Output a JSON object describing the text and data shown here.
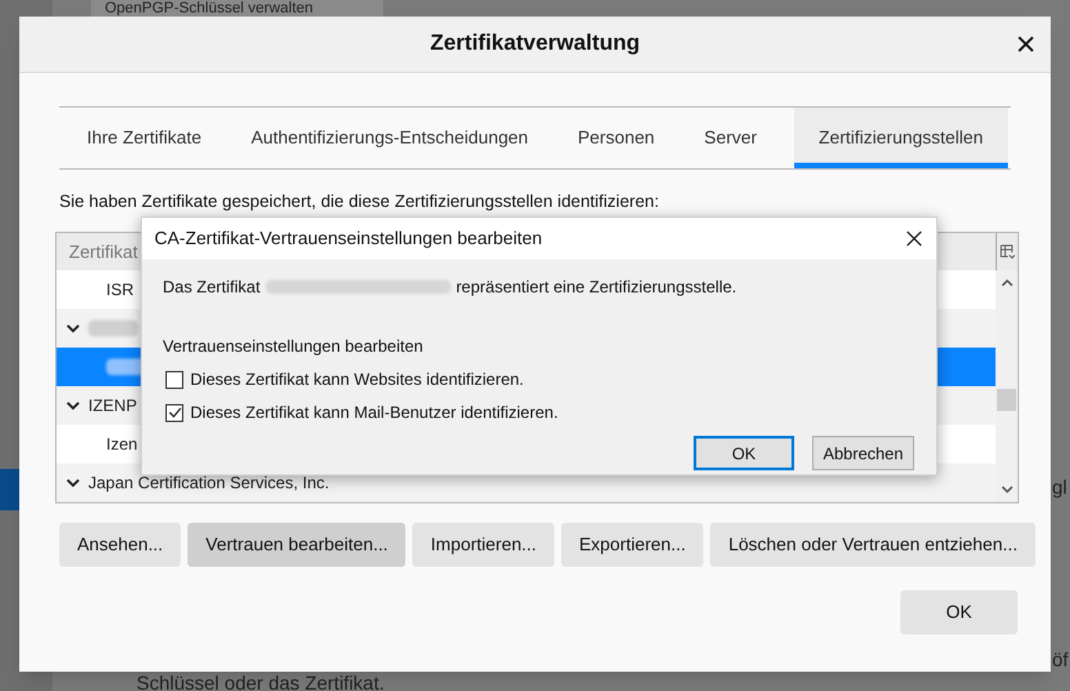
{
  "background_window": {
    "tab_label": "OpenPGP-Schlüssel verwalten",
    "footer_text": "Schlüssel oder das Zertifikat.",
    "side_text_1": "gl",
    "side_text_2": "öf"
  },
  "window": {
    "title": "Zertifikatverwaltung"
  },
  "tabs": [
    {
      "label": "Ihre Zertifikate",
      "selected": false
    },
    {
      "label": "Authentifizierungs-Entscheidungen",
      "selected": false
    },
    {
      "label": "Personen",
      "selected": false
    },
    {
      "label": "Server",
      "selected": false
    },
    {
      "label": "Zertifizierungsstellen",
      "selected": true
    }
  ],
  "description": "Sie haben Zertifikate gespeichert, die diese Zertifizierungsstellen identifizieren:",
  "tree": {
    "columns": [
      "Zertifikat"
    ],
    "rows": [
      {
        "kind": "cert",
        "name": "ISR",
        "blurred": false,
        "selected": false
      },
      {
        "kind": "group",
        "name": "",
        "blurred": true,
        "expanded": true,
        "selected": false
      },
      {
        "kind": "cert",
        "name": "",
        "blurred": true,
        "selected": true
      },
      {
        "kind": "group",
        "name": "IZENP",
        "blurred": false,
        "expanded": true,
        "selected": false
      },
      {
        "kind": "cert",
        "name": "Izen",
        "blurred": false,
        "selected": false
      },
      {
        "kind": "group",
        "name": "Japan Certification Services, Inc.",
        "blurred": false,
        "expanded": true,
        "selected": false
      }
    ]
  },
  "buttons": [
    {
      "label": "Ansehen...",
      "hovered": false
    },
    {
      "label": "Vertrauen bearbeiten...",
      "hovered": true
    },
    {
      "label": "Importieren...",
      "hovered": false
    },
    {
      "label": "Exportieren...",
      "hovered": false
    },
    {
      "label": "Löschen oder Vertrauen entziehen...",
      "hovered": false
    }
  ],
  "ok_button": "OK",
  "trust_dialog": {
    "title": "CA-Zertifikat-Vertrauenseinstellungen bearbeiten",
    "message_before": "Das Zertifikat",
    "message_after": "repräsentiert eine Zertifizierungsstelle.",
    "section_label": "Vertrauenseinstellungen bearbeiten",
    "options": [
      {
        "label": "Dieses Zertifikat kann Websites identifizieren.",
        "checked": false
      },
      {
        "label": "Dieses Zertifikat kann Mail-Benutzer identifizieren.",
        "checked": true
      }
    ],
    "ok_button": "OK",
    "cancel_button": "Abbrechen"
  }
}
